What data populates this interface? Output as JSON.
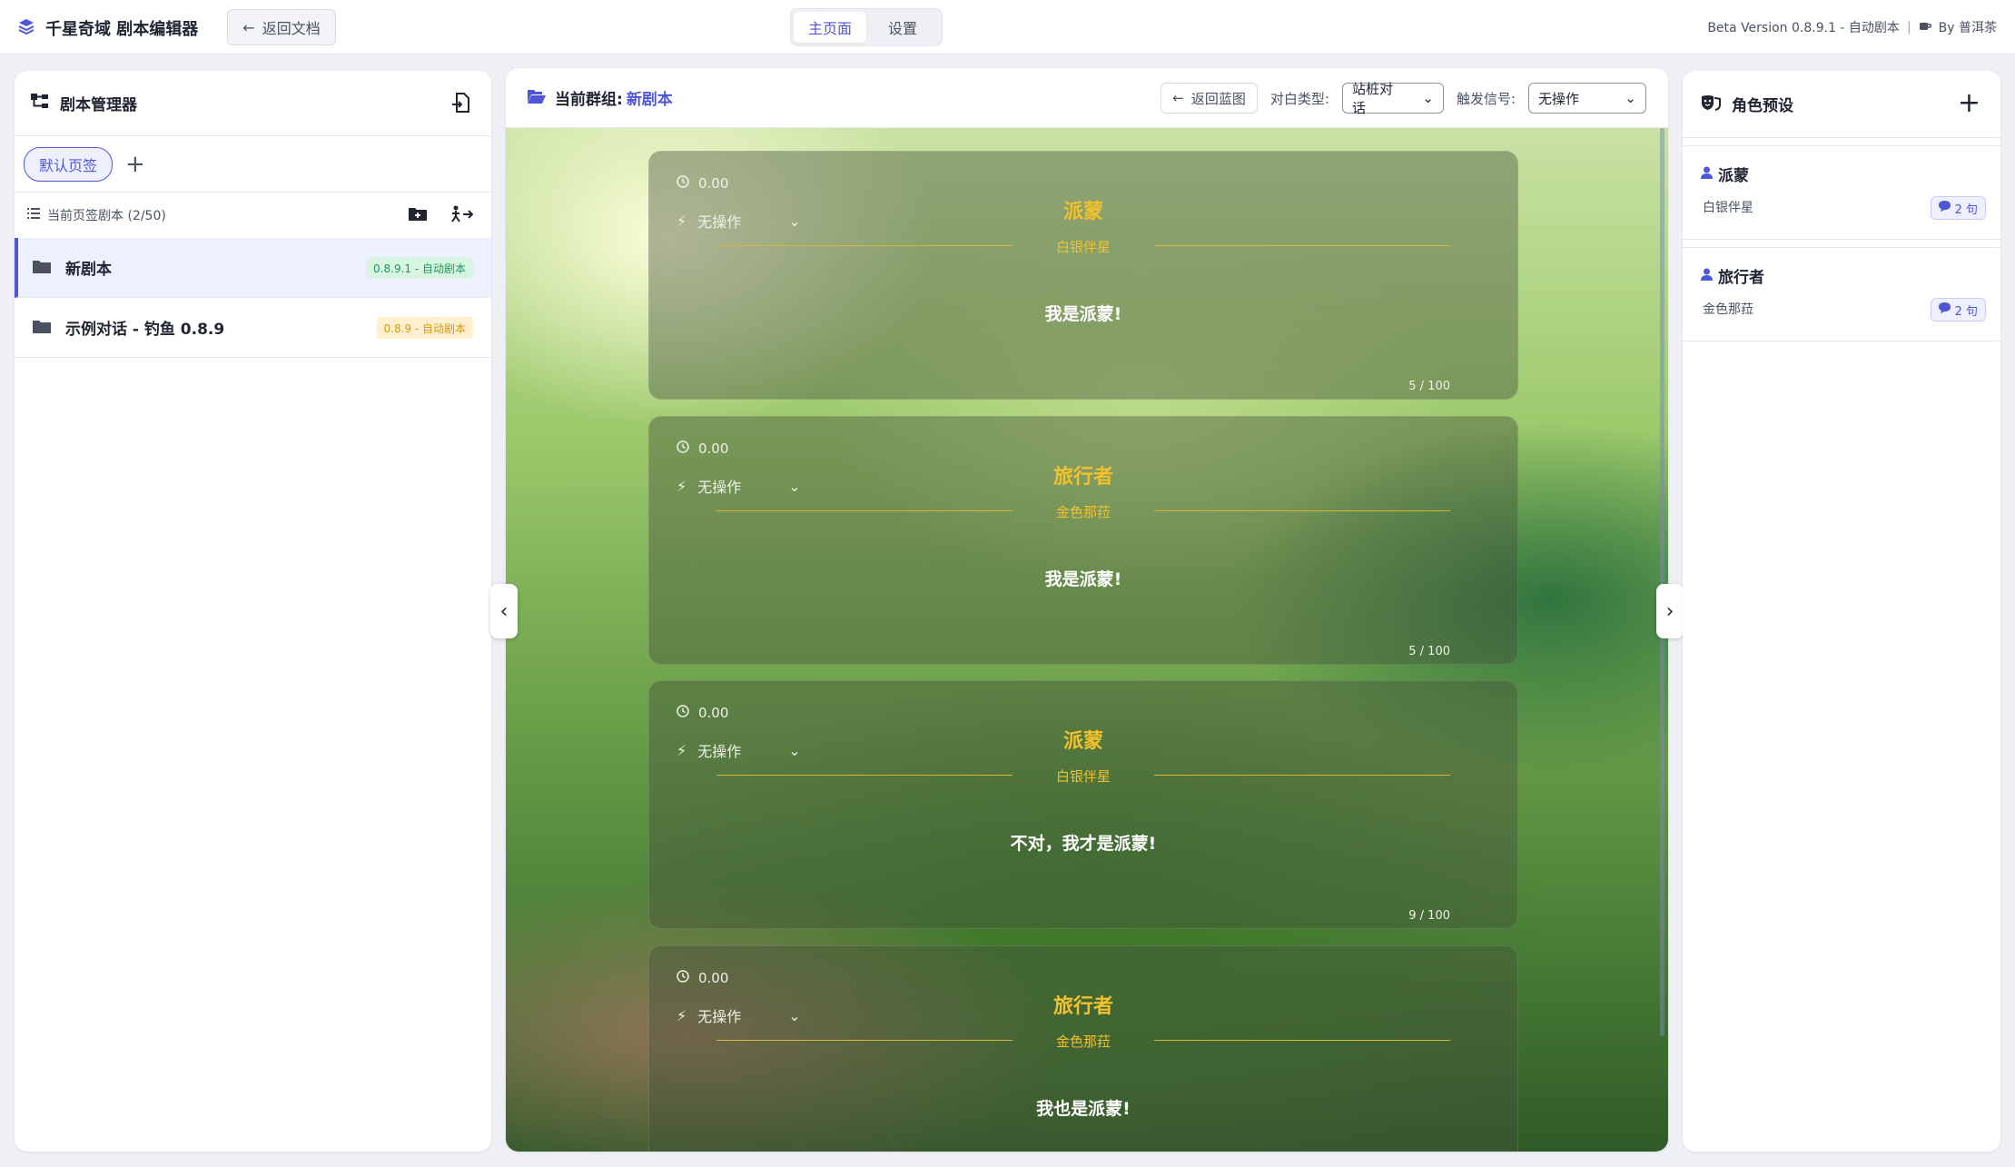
{
  "app": {
    "title": "千星奇域 剧本编辑器",
    "back_doc_label": "返回文档",
    "tabs": [
      {
        "label": "主页面",
        "active": true
      },
      {
        "label": "设置",
        "active": false
      }
    ],
    "version_text": "Beta Version 0.8.9.1 - 自动剧本",
    "separator": "|",
    "author_text": "By 普洱茶",
    "accent_color": "#4f56d8"
  },
  "left_panel": {
    "title": "剧本管理器",
    "page_tabs": [
      {
        "label": "默认页签",
        "active": true
      }
    ],
    "add_tab_label": "+",
    "list_header": "当前页签剧本 (2/50)",
    "scripts": [
      {
        "name": "新剧本",
        "badge": "0.8.9.1 - 自动剧本",
        "badge_color": "green",
        "active": true
      },
      {
        "name": "示例对话 - 钓鱼 0.8.9",
        "badge": "0.8.9 - 自动剧本",
        "badge_color": "yellow",
        "active": false
      }
    ]
  },
  "center_panel": {
    "group_label": "当前群组:",
    "group_name": "新剧本",
    "back_blueprint_label": "返回蓝图",
    "dialog_type_label": "对白类型:",
    "dialog_type_value": "站桩对话",
    "trigger_label": "触发信号:",
    "trigger_value": "无操作",
    "cards": [
      {
        "time": "0.00",
        "action": "无操作",
        "character": "派蒙",
        "title": "白银伴星",
        "text": "我是派蒙!",
        "count": "5 / 100"
      },
      {
        "time": "0.00",
        "action": "无操作",
        "character": "旅行者",
        "title": "金色那菈",
        "text": "我是派蒙!",
        "count": "5 / 100"
      },
      {
        "time": "0.00",
        "action": "无操作",
        "character": "派蒙",
        "title": "白银伴星",
        "text": "不对，我才是派蒙!",
        "count": "9 / 100"
      },
      {
        "time": "0.00",
        "action": "无操作",
        "character": "旅行者",
        "title": "金色那菈",
        "text": "我也是派蒙!",
        "count": ""
      }
    ]
  },
  "right_panel": {
    "title": "角色预设",
    "add_label": "+",
    "roles": [
      {
        "name": "派蒙",
        "subtitle": "白银伴星",
        "count": "2 句"
      },
      {
        "name": "旅行者",
        "subtitle": "金色那菈",
        "count": "2 句"
      }
    ]
  },
  "collapse": {
    "left": "‹",
    "right": "›"
  }
}
